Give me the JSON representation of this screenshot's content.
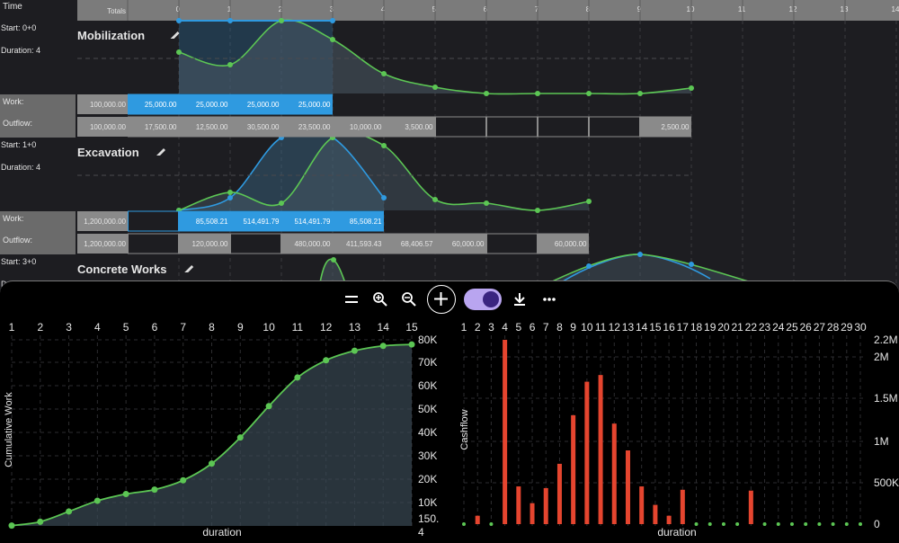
{
  "header": {
    "time_label": "Time",
    "totals_label": "Totals",
    "columns": [
      "0",
      "1",
      "2",
      "3",
      "4",
      "5",
      "6",
      "7",
      "8",
      "9",
      "10",
      "11",
      "12",
      "13",
      "14"
    ]
  },
  "row_labels": {
    "work": "Work:",
    "outflow": "Outflow:"
  },
  "activities": [
    {
      "name": "Mobilization",
      "start": "Start: 0+0",
      "duration": "Duration: 4",
      "work_total": "100,000.00",
      "outflow_total": "100,000.00",
      "work_cells": [
        "25,000.00",
        "25,000.00",
        "25,000.00",
        "25,000.00",
        "",
        "",
        "",
        "",
        "",
        "",
        "",
        "",
        "",
        "",
        ""
      ],
      "outflow_cells": [
        "17,500.00",
        "12,500.00",
        "30,500.00",
        "23,500.00",
        "10,000.00",
        "3,500.00",
        "",
        "",
        "",
        "",
        "2,500.00",
        "",
        "",
        "",
        ""
      ]
    },
    {
      "name": "Excavation",
      "start": "Start: 1+0",
      "duration": "Duration: 4",
      "work_total": "1,200,000.00",
      "outflow_total": "1,200,000.00",
      "work_cells": [
        "",
        "85,508.21",
        "514,491.79",
        "514,491.79",
        "85,508.21",
        "",
        "",
        "",
        "",
        "",
        "",
        "",
        "",
        "",
        ""
      ],
      "outflow_cells": [
        "",
        "120,000.00",
        "",
        "480,000.00",
        "411,593.43",
        "68,406.57",
        "60,000.00",
        "",
        "60,000.00",
        "",
        "",
        "",
        "",
        "",
        ""
      ]
    },
    {
      "name": "Concrete Works",
      "start": "Start: 3+0",
      "duration": "Duration: 4"
    }
  ],
  "toolbar": {
    "icons": [
      "equals-icon",
      "zoom-in-icon",
      "zoom-out-icon",
      "add-icon",
      "toggle",
      "download-icon",
      "more-icon"
    ]
  },
  "colors": {
    "accent_blue": "#2f9ae0",
    "green": "#5cc654",
    "bar_red": "#e5452f"
  },
  "chart_data": [
    {
      "type": "area",
      "xlabel": "duration",
      "ylabel": "Cumulative Work",
      "x_ticks": [
        "1",
        "2",
        "3",
        "4",
        "5",
        "6",
        "7",
        "8",
        "9",
        "10",
        "11",
        "12",
        "13",
        "14",
        "15"
      ],
      "y_ticks": [
        "80K",
        "70K",
        "60K",
        "50K",
        "40K",
        "30K",
        "20K",
        "10K",
        "150.",
        "4"
      ],
      "x": [
        0,
        1,
        2,
        3,
        4,
        5,
        6,
        7,
        8,
        9,
        10,
        11,
        12,
        13,
        14
      ],
      "y": [
        150,
        1800,
        6200,
        10800,
        13700,
        15600,
        19600,
        26800,
        38000,
        51500,
        63800,
        71200,
        75300,
        77400,
        78000
      ]
    },
    {
      "type": "bar",
      "xlabel": "duration",
      "ylabel": "Cashflow",
      "x_ticks": [
        "1",
        "2",
        "3",
        "4",
        "5",
        "6",
        "7",
        "8",
        "9",
        "10",
        "11",
        "12",
        "13",
        "14",
        "15",
        "16",
        "17",
        "18",
        "19",
        "20",
        "21",
        "22",
        "23",
        "24",
        "25",
        "26",
        "27",
        "28",
        "29",
        "30"
      ],
      "y_ticks": [
        "2.2M",
        "2M",
        "1.5M",
        "1M",
        "500K",
        "0"
      ],
      "x": [
        1,
        2,
        3,
        4,
        5,
        6,
        7,
        8,
        9,
        10,
        11,
        12,
        13,
        14,
        15,
        16,
        17,
        18,
        19,
        20,
        21,
        22,
        23,
        24,
        25,
        26,
        27,
        28,
        29,
        30
      ],
      "values": [
        0,
        100000,
        0,
        2200000,
        450000,
        250000,
        430000,
        720000,
        1300000,
        1700000,
        1780000,
        1200000,
        880000,
        450000,
        230000,
        100000,
        410000,
        0,
        0,
        0,
        0,
        400000,
        0,
        0,
        0,
        0,
        0,
        0,
        0,
        0
      ]
    }
  ]
}
